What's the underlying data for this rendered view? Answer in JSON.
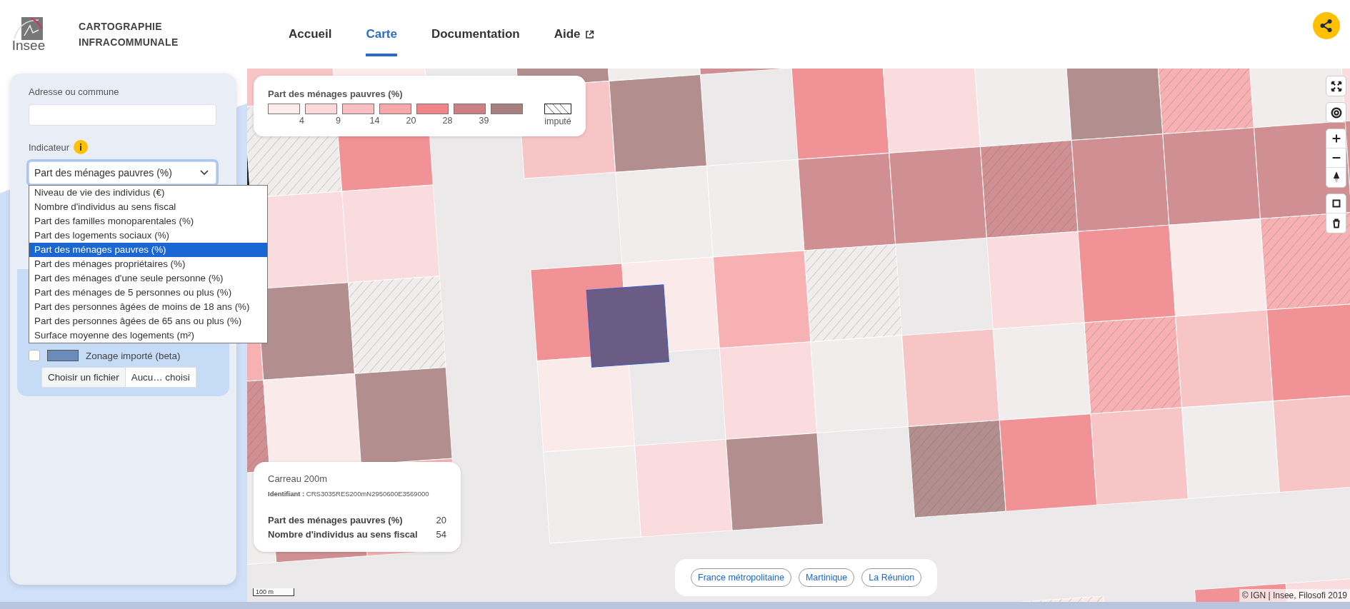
{
  "header": {
    "logo_text": "Insee",
    "app_title": "CARTOGRAPHIE INFRACOMMUNALE",
    "nav": [
      {
        "label": "Accueil",
        "selected": false,
        "external": false
      },
      {
        "label": "Carte",
        "selected": true,
        "external": false
      },
      {
        "label": "Documentation",
        "selected": false,
        "external": false
      },
      {
        "label": "Aide",
        "selected": false,
        "external": true
      }
    ]
  },
  "sidebar": {
    "address_label": "Adresse ou commune",
    "indicator": {
      "label": "Indicateur",
      "value": "Part des ménages pauvres (%)",
      "expanded": true,
      "options": [
        {
          "label": "Niveau de vie des individus (€)",
          "selected": false
        },
        {
          "label": "Nombre d'individus au sens fiscal",
          "selected": false
        },
        {
          "label": "Part des familles monoparentales (%)",
          "selected": false
        },
        {
          "label": "Part des logements sociaux (%)",
          "selected": false
        },
        {
          "label": "Part des ménages pauvres (%)",
          "selected": true
        },
        {
          "label": "Part des ménages propriétaires (%)",
          "selected": false
        },
        {
          "label": "Part des ménages d'une seule personne (%)",
          "selected": false
        },
        {
          "label": "Part des ménages de 5 personnes ou plus (%)",
          "selected": false
        },
        {
          "label": "Part des personnes âgées de moins de 18 ans (%)",
          "selected": false
        },
        {
          "label": "Part des personnes âgées de 65 ans ou plus (%)",
          "selected": false
        },
        {
          "label": "Surface moyenne des logements (m²)",
          "selected": false
        }
      ]
    },
    "layers": [
      {
        "label": "Zonage importé (beta)",
        "checked": false,
        "color": "#6a8cba"
      }
    ],
    "file": {
      "button": "Choisir un fichier",
      "status": "Aucu… choisi"
    }
  },
  "legend": {
    "title": "Part des ménages pauvres (%)",
    "classes": [
      {
        "color": "#fdeceb"
      },
      {
        "color": "#fdd9dc"
      },
      {
        "color": "#fbbfc1"
      },
      {
        "color": "#f9a8a9"
      },
      {
        "color": "#f28489"
      },
      {
        "color": "#cc8084"
      },
      {
        "color": "#a87f7f"
      }
    ],
    "breaks": [
      "4",
      "9",
      "14",
      "20",
      "28",
      "39"
    ],
    "imputed_label": "imputé"
  },
  "info": {
    "title": "Carreau 200m",
    "identifier": "**Identifiant :** CRS3035RES200mN2950600E3569000",
    "rows": [
      {
        "label": "Part des ménages pauvres (%)",
        "value": "20"
      },
      {
        "label": "Nombre d'individus au sens fiscal",
        "value": "54"
      }
    ]
  },
  "map_controls": [
    {
      "kind": "fullscreen"
    },
    {
      "kind": "locate"
    },
    {
      "kind": "zoom_in"
    },
    {
      "kind": "zoom_out"
    },
    {
      "kind": "compass"
    },
    {
      "kind": "draw"
    },
    {
      "kind": "delete"
    }
  ],
  "territories": [
    "France métropolitaine",
    "Martinique",
    "La Réunion"
  ],
  "scale": "100 m",
  "attribution": "© IGN | Insee, Filosofi 2019"
}
